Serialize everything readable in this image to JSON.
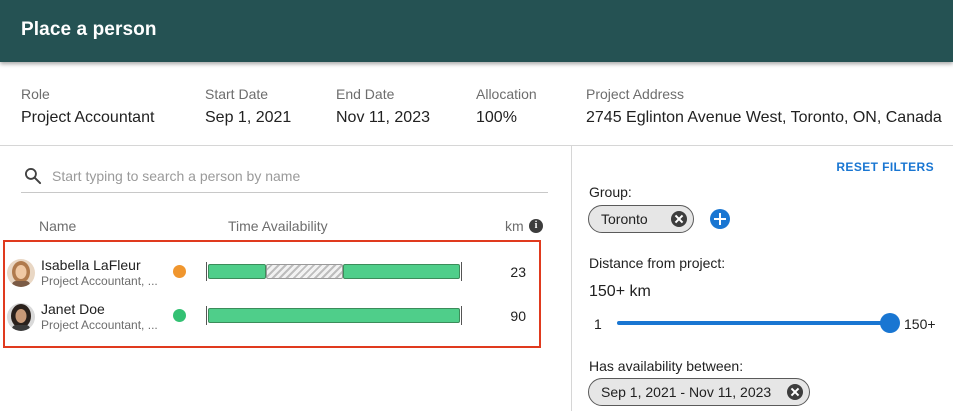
{
  "header": {
    "title": "Place a person"
  },
  "project": {
    "role_label": "Role",
    "role_value": "Project Accountant",
    "start_label": "Start Date",
    "start_value": "Sep 1, 2021",
    "end_label": "End Date",
    "end_value": "Nov 11, 2023",
    "allocation_label": "Allocation",
    "allocation_value": "100%",
    "address_label": "Project Address",
    "address_value": "2745 Eglinton Avenue West, Toronto, ON, Canada"
  },
  "search": {
    "placeholder": "Start typing to search a person by name",
    "icon": "search-icon"
  },
  "columns": {
    "name": "Name",
    "time": "Time Availability",
    "km": "km"
  },
  "people": [
    {
      "name": "Isabella LaFleur",
      "role": "Project Accountant, ...",
      "status_color": "#f0962e",
      "availability": [
        "available",
        "unavailable",
        "available"
      ],
      "km": "23"
    },
    {
      "name": "Janet Doe",
      "role": "Project Accountant, ...",
      "status_color": "#33c173",
      "availability": [
        "available"
      ],
      "km": "90"
    }
  ],
  "filters": {
    "reset_label": "RESET FILTERS",
    "group_label": "Group:",
    "group_chip": "Toronto",
    "distance_label": "Distance from project:",
    "distance_value": "150+ km",
    "slider_min": "1",
    "slider_max": "150+",
    "slider_fraction": 1.0,
    "availability_label": "Has availability between:",
    "availability_chip": "Sep 1, 2021 - Nov 11, 2023"
  },
  "colors": {
    "header_bg": "#255253",
    "accent": "#1976d2",
    "highlight_border": "#e03a1e",
    "bar_green": "#4fce8a"
  }
}
